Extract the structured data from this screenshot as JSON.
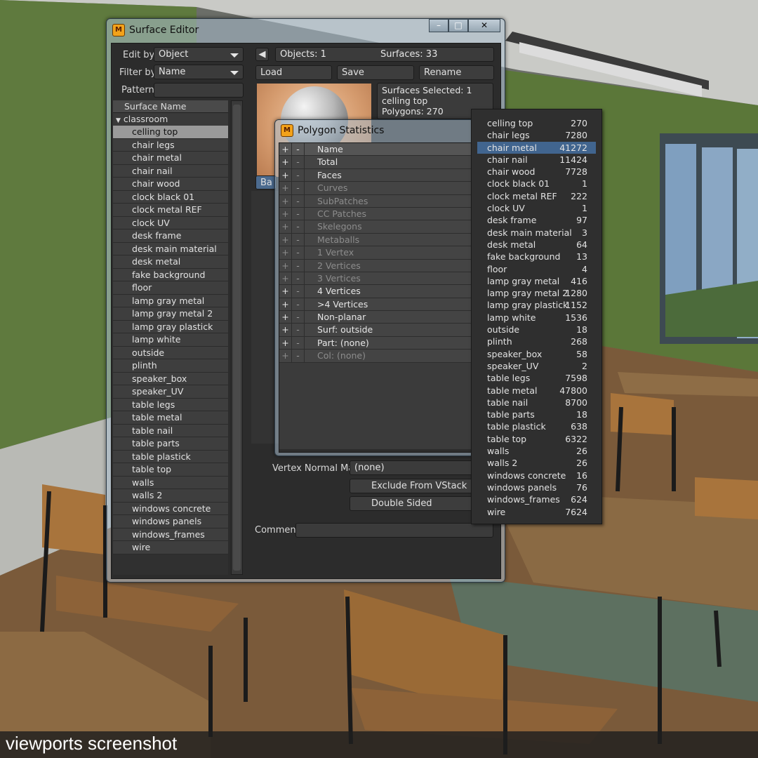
{
  "caption": "viewports screenshot",
  "surface_editor": {
    "title": "Surface Editor",
    "icon": "lightwave-modeler-icon",
    "window_buttons": {
      "minimize": "–",
      "maximize": "□",
      "close": "✕"
    },
    "edit_by": {
      "label": "Edit by",
      "value": "Object"
    },
    "filter_by": {
      "label": "Filter by",
      "value": "Name"
    },
    "pattern": {
      "label": "Pattern",
      "value": ""
    },
    "objects": "Objects: 1",
    "surfaces": "Surfaces: 33",
    "buttons": {
      "load": "Load",
      "save": "Save",
      "rename": "Rename",
      "basic_tab": "Ba"
    },
    "info": {
      "selected": "Surfaces Selected: 1",
      "name": "celling top",
      "polygons": "Polygons: 270"
    },
    "list_header": "Surface Name",
    "group": "classroom",
    "surfaces_list": [
      "celling top",
      "chair legs",
      "chair metal",
      "chair nail",
      "chair wood",
      "clock black 01",
      "clock metal REF",
      "clock UV",
      "desk frame",
      "desk main material",
      "desk metal",
      "fake background",
      "floor",
      "lamp gray metal",
      "lamp gray metal 2",
      "lamp gray plastick",
      "lamp white",
      "outside",
      "plinth",
      "speaker_box",
      "speaker_UV",
      "table legs",
      "table metal",
      "table nail",
      "table parts",
      "table plastick",
      "table top",
      "walls",
      "walls 2",
      "windows concrete",
      "windows panels",
      "windows_frames",
      "wire"
    ],
    "selected_surface": "celling top",
    "vertex_normal_map": {
      "label": "Vertex Normal Map",
      "value": "(none)"
    },
    "exclude_from_vstack": "Exclude From VStack",
    "double_sided": "Double Sided",
    "comment": {
      "label": "Comment",
      "value": ""
    }
  },
  "polygon_statistics": {
    "title": "Polygon Statistics",
    "header": {
      "plus": "+",
      "minus": "-",
      "name": "Name"
    },
    "rows": [
      {
        "name": "Total",
        "enabled": true
      },
      {
        "name": "Faces",
        "enabled": true
      },
      {
        "name": "Curves",
        "enabled": false
      },
      {
        "name": "SubPatches",
        "enabled": false
      },
      {
        "name": "CC Patches",
        "enabled": false
      },
      {
        "name": "Skelegons",
        "enabled": false
      },
      {
        "name": "Metaballs",
        "enabled": false
      },
      {
        "name": "1 Vertex",
        "enabled": false
      },
      {
        "name": "2 Vertices",
        "enabled": false
      },
      {
        "name": "3 Vertices",
        "enabled": false
      },
      {
        "name": "4 Vertices",
        "enabled": true
      },
      {
        "name": ">4 Vertices",
        "enabled": true
      },
      {
        "name": "Non-planar",
        "enabled": true
      },
      {
        "name": "Surf: outside",
        "enabled": true
      },
      {
        "name": "Part: (none)",
        "enabled": true
      },
      {
        "name": "Col: (none)",
        "enabled": false
      }
    ]
  },
  "surface_counts": {
    "selected": "chair metal",
    "items": [
      {
        "name": "celling top",
        "count": "270"
      },
      {
        "name": "chair legs",
        "count": "7280"
      },
      {
        "name": "chair metal",
        "count": "41272"
      },
      {
        "name": "chair nail",
        "count": "11424"
      },
      {
        "name": "chair wood",
        "count": "7728"
      },
      {
        "name": "clock black 01",
        "count": "1"
      },
      {
        "name": "clock metal REF",
        "count": "222"
      },
      {
        "name": "clock UV",
        "count": "1"
      },
      {
        "name": "desk frame",
        "count": "97"
      },
      {
        "name": "desk main material",
        "count": "3"
      },
      {
        "name": "desk metal",
        "count": "64"
      },
      {
        "name": "fake background",
        "count": "13"
      },
      {
        "name": "floor",
        "count": "4"
      },
      {
        "name": "lamp gray metal",
        "count": "416"
      },
      {
        "name": "lamp gray metal 2",
        "count": "1280"
      },
      {
        "name": "lamp gray plastick",
        "count": "1152"
      },
      {
        "name": "lamp white",
        "count": "1536"
      },
      {
        "name": "outside",
        "count": "18"
      },
      {
        "name": "plinth",
        "count": "268"
      },
      {
        "name": "speaker_box",
        "count": "58"
      },
      {
        "name": "speaker_UV",
        "count": "2"
      },
      {
        "name": "table legs",
        "count": "7598"
      },
      {
        "name": "table metal",
        "count": "47800"
      },
      {
        "name": "table nail",
        "count": "8700"
      },
      {
        "name": "table parts",
        "count": "18"
      },
      {
        "name": "table plastick",
        "count": "638"
      },
      {
        "name": "table top",
        "count": "6322"
      },
      {
        "name": "walls",
        "count": "26"
      },
      {
        "name": "walls 2",
        "count": "26"
      },
      {
        "name": "windows concrete",
        "count": "16"
      },
      {
        "name": "windows panels",
        "count": "76"
      },
      {
        "name": "windows_frames",
        "count": "624"
      },
      {
        "name": "wire",
        "count": "7624"
      }
    ]
  },
  "colors": {
    "selection": "#41658f",
    "wall": "#5e7a3c",
    "panel": "#2c2c2c"
  }
}
